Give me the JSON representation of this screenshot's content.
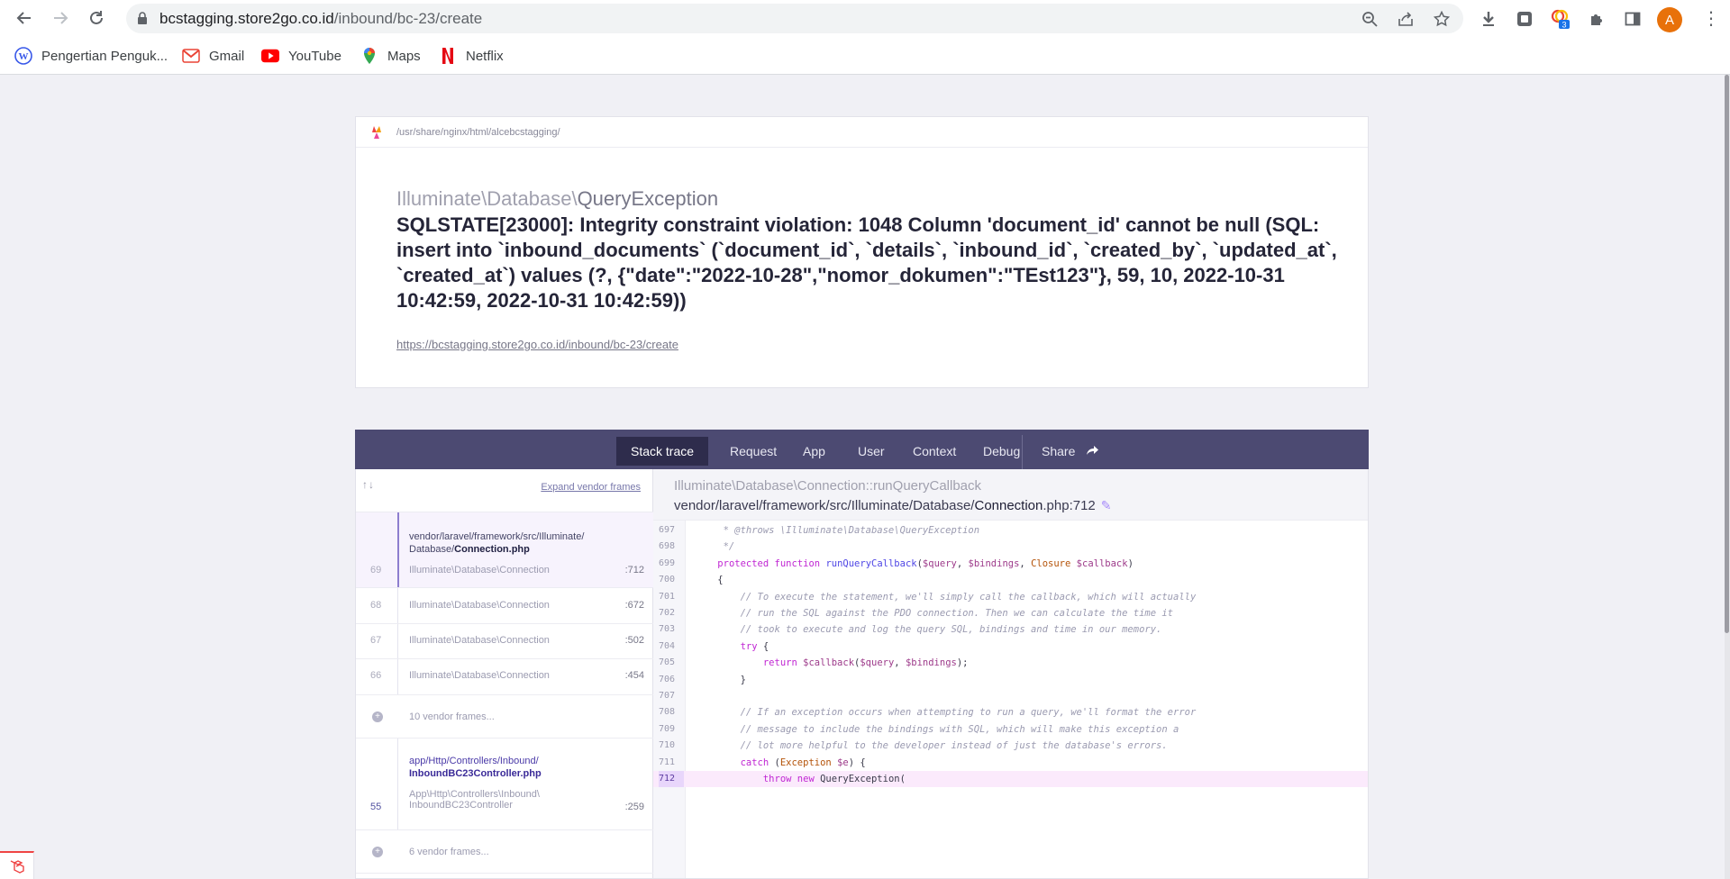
{
  "browser": {
    "url_host": "bcstagging.store2go.co.id",
    "url_path": "/inbound/bc-23/create",
    "extension_badge": "3",
    "profile_initial": "A",
    "bookmarks": [
      {
        "label": "Pengertian Penguk..."
      },
      {
        "label": "Gmail"
      },
      {
        "label": "YouTube"
      },
      {
        "label": "Maps"
      },
      {
        "label": "Netflix"
      }
    ]
  },
  "error": {
    "app_path": "/usr/share/nginx/html/alcebcstagging/",
    "exception_namespace": "Illuminate\\Database\\",
    "exception_name": "QueryException",
    "message": "SQLSTATE[23000]: Integrity constraint violation: 1048 Column 'document_id' cannot be null (SQL: insert into `inbound_documents` (`document_id`, `details`, `inbound_id`, `created_by`, `updated_at`, `created_at`) values (?, {\"date\":\"2022-10-28\",\"nomor_dokumen\":\"TEst123\"}, 59, 10, 2022-10-31 10:42:59, 2022-10-31 10:42:59))",
    "url": "https://bcstagging.store2go.co.id/inbound/bc-23/create"
  },
  "tabs": [
    {
      "label": "Stack trace"
    },
    {
      "label": "Request"
    },
    {
      "label": "App"
    },
    {
      "label": "User"
    },
    {
      "label": "Context"
    },
    {
      "label": "Debug"
    },
    {
      "label": "Share"
    }
  ],
  "frames_panel": {
    "expand_label": "Expand vendor frames",
    "frames": [
      {
        "number": "69",
        "file_dir": "vendor/laravel/framework/src/Illuminate/",
        "file_base": "Database/",
        "file_name": "Connection.php",
        "class": "Illuminate\\Database\\Connection",
        "line": ":712"
      },
      {
        "number": "68",
        "class": "Illuminate\\Database\\Connection",
        "line": ":672"
      },
      {
        "number": "67",
        "class": "Illuminate\\Database\\Connection",
        "line": ":502"
      },
      {
        "number": "66",
        "class": "Illuminate\\Database\\Connection",
        "line": ":454"
      }
    ],
    "vendor_group_1": "10 vendor frames...",
    "app_frame": {
      "number": "55",
      "file_dir": "app/Http/Controllers/Inbound/",
      "file_name": "InboundBC23Controller.php",
      "class_1": "App\\Http\\Controllers\\Inbound\\",
      "class_2": "InboundBC23Controller",
      "line": ":259"
    },
    "vendor_group_2": "6 vendor frames..."
  },
  "code": {
    "class_prefix": "Illuminate\\Database\\Connection::",
    "method": "runQueryCallback",
    "file_dir": "vendor/laravel/framework/src/Illuminate/Database/",
    "file_name": "Connection",
    "file_ext": ".php:712",
    "lines": [
      {
        "n": "697",
        "text": "     * @throws \\Illuminate\\Database\\QueryException"
      },
      {
        "n": "698",
        "text": "     */"
      },
      {
        "n": "699",
        "text": "    protected function runQueryCallback($query, $bindings, Closure $callback)"
      },
      {
        "n": "700",
        "text": "    {"
      },
      {
        "n": "701",
        "text": "        // To execute the statement, we'll simply call the callback, which will actually"
      },
      {
        "n": "702",
        "text": "        // run the SQL against the PDO connection. Then we can calculate the time it"
      },
      {
        "n": "703",
        "text": "        // took to execute and log the query SQL, bindings and time in our memory."
      },
      {
        "n": "704",
        "text": "        try {"
      },
      {
        "n": "705",
        "text": "            return $callback($query, $bindings);"
      },
      {
        "n": "706",
        "text": "        }"
      },
      {
        "n": "707",
        "text": ""
      },
      {
        "n": "708",
        "text": "        // If an exception occurs when attempting to run a query, we'll format the error"
      },
      {
        "n": "709",
        "text": "        // message to include the bindings with SQL, which will make this exception a"
      },
      {
        "n": "710",
        "text": "        // lot more helpful to the developer instead of just the database's errors."
      },
      {
        "n": "711",
        "text": "        catch (Exception $e) {"
      },
      {
        "n": "712",
        "text": "            throw new QueryException("
      }
    ]
  },
  "colors": {
    "tab_bar": "#4c4a72",
    "tab_active": "#2e2c4c",
    "avatar": "#e8710a"
  }
}
